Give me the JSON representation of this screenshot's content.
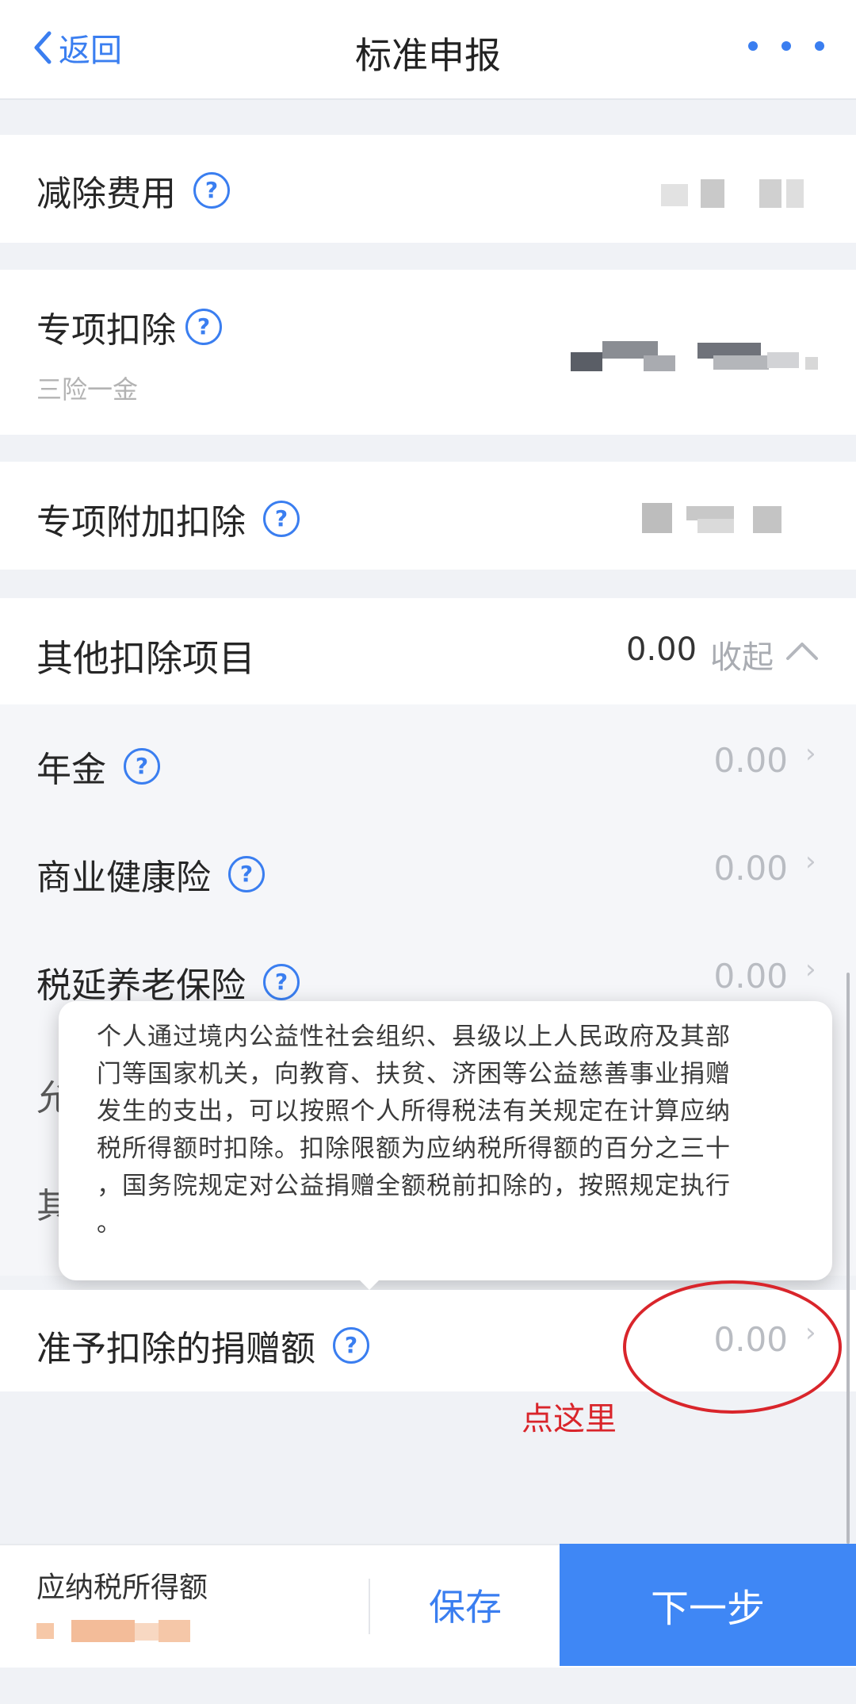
{
  "header": {
    "back_label": "返回",
    "title": "标准申报"
  },
  "sections": {
    "deduction_fee": {
      "label": "减除费用"
    },
    "special_deduction": {
      "label": "专项扣除",
      "sub": "三险一金"
    },
    "special_additional": {
      "label": "专项附加扣除"
    },
    "other": {
      "label": "其他扣除项目",
      "value": "0.00",
      "toggle": "收起"
    }
  },
  "other_items": [
    {
      "label": "年金",
      "value": "0.00"
    },
    {
      "label": "商业健康险",
      "value": "0.00"
    },
    {
      "label": "税延养老保险",
      "value": "0.00"
    }
  ],
  "partial_labels": [
    "允",
    "其"
  ],
  "tooltip": {
    "lines": [
      "个人通过境内公益性社会组织、县级以上人民政府及其部",
      "门等国家机关，向教育、扶贫、济困等公益慈善事业捐赠",
      "发生的支出，可以按照个人所得税法有关规定在计算应纳",
      "税所得额时扣除。扣除限额为应纳税所得额的百分之三十",
      "，国务院规定对公益捐赠全额税前扣除的，按照规定执行",
      "。"
    ]
  },
  "donation": {
    "label": "准予扣除的捐赠额",
    "value": "0.00"
  },
  "annotation": {
    "text": "点这里"
  },
  "bottom_bar": {
    "tax_label": "应纳税所得额",
    "save_label": "保存",
    "next_label": "下一步"
  },
  "colors": {
    "accent": "#3a7ef0",
    "primary_button": "#3f87f5",
    "annotation_red": "#d9252b"
  }
}
